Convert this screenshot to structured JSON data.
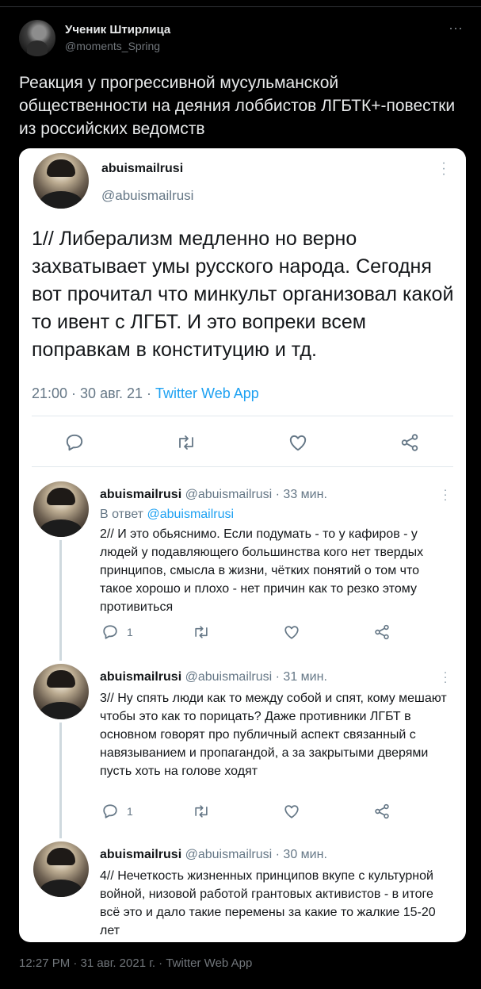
{
  "outer": {
    "author_name": "Ученик Штирлица",
    "author_handle": "@moments_Spring",
    "more_icon": "⋯",
    "text": "Реакция у прогрессивной мусульманской общественности на деяния лоббистов ЛГБТК+-повестки из российских ведомств",
    "footer": "12:27 PM · 31 авг. 2021 г. · Twitter Web App"
  },
  "card": {
    "main": {
      "name": "abuismailrusi",
      "handle": "@abuismailrusi",
      "text": "1// Либерализм медленно но верно захватывает умы русского народа. Сегодня вот прочитал что минкульт организовал какой то ивент с ЛГБТ. И это вопреки всем поправкам в конституцию и тд.",
      "time": "21:00 · 30 авг. 21 · ",
      "app": "Twitter Web App"
    },
    "replies": [
      {
        "name": "abuismailrusi",
        "meta": " @abuismailrusi · 33 мин.",
        "in_reply_label": "В ответ ",
        "in_reply_handle": "@abuismailrusi",
        "text": "2// И это обьяснимо. Если подумать - то у кафиров - у людей у подавляющего большинства кого нет твердых принципов, смысла в жизни, чётких понятий о том что такое хорошо и плохо - нет причин как то резко этому противиться",
        "reply_count": "1"
      },
      {
        "name": "abuismailrusi",
        "meta": " @abuismailrusi · 31 мин.",
        "text": "3// Ну спять люди как то между собой и спят, кому мешают чтобы это как то порицать? Даже противники ЛГБТ в основном говорят про публичный аспект связанный с навязыванием и пропагандой, а за закрытыми дверями пусть хоть на голове ходят",
        "reply_count": "1"
      },
      {
        "name": "abuismailrusi",
        "meta": " @abuismailrusi · 30 мин.",
        "text": "4// Нечеткость жизненных принципов вкупе с культурной войной, низовой работой грантовых активистов - в итоге всё это и дало такие перемены за какие то жалкие 15-20 лет"
      }
    ]
  },
  "colors": {
    "background": "#000000",
    "card": "#ffffff",
    "link": "#1da1f2",
    "muted": "#657786"
  },
  "icons": [
    "reply-icon",
    "retweet-icon",
    "like-icon",
    "share-icon",
    "more-icon"
  ]
}
